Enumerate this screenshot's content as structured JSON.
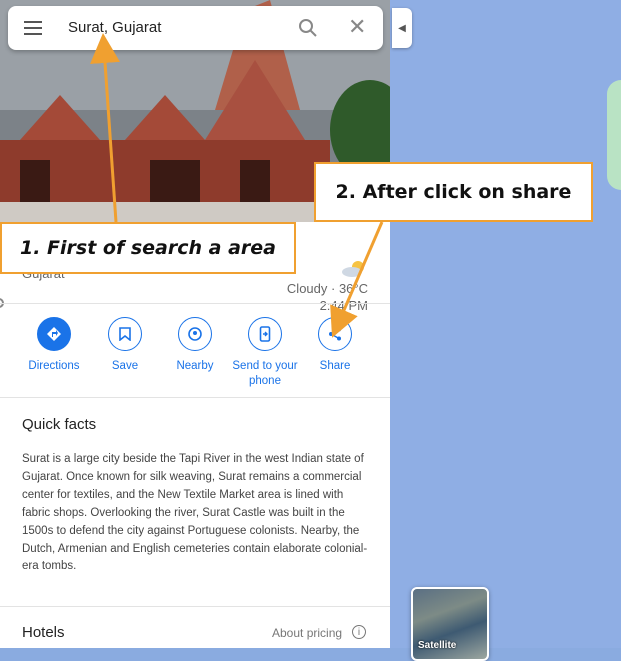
{
  "search": {
    "query": "Surat, Gujarat"
  },
  "place": {
    "region": "Gujarat",
    "weather": "Cloudy · 36°C",
    "time": "2:44 PM"
  },
  "actions": [
    {
      "label": "Directions"
    },
    {
      "label": "Save"
    },
    {
      "label": "Nearby"
    },
    {
      "label": "Send to your phone"
    },
    {
      "label": "Share"
    }
  ],
  "quick_facts": {
    "title": "Quick facts",
    "text": "Surat is a large city beside the Tapi River in the west Indian state of Gujarat. Once known for silk weaving, Surat remains a commercial center for textiles, and the New Textile Market area is lined with fabric shops. Overlooking the river, Surat Castle was built in the 1500s to defend the city against Portuguese colonists. Nearby, the Dutch, Armenian and English cemeteries contain elaborate colonial-era tombs."
  },
  "hotels": {
    "title": "Hotels",
    "pricing": "About pricing"
  },
  "map": {
    "satellite_label": "Satellite"
  },
  "annotations": {
    "step1": "1. First of search a area",
    "step2": "2. After click on share",
    "color": "#f0a030"
  }
}
